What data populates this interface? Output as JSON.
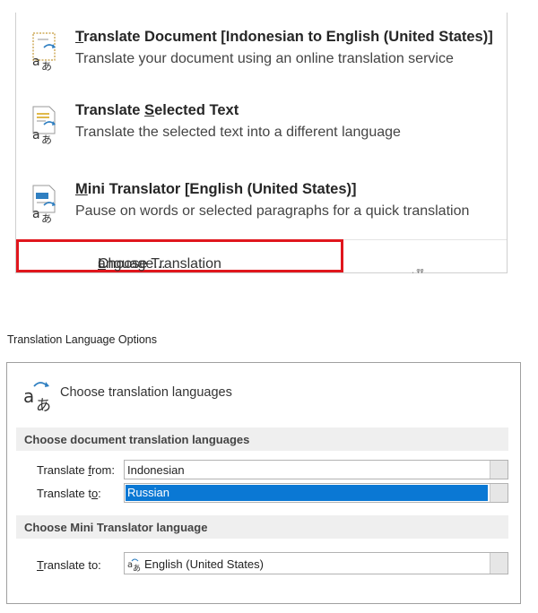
{
  "menu": {
    "items": [
      {
        "title_accel": "T",
        "title_rest": "ranslate Document [Indonesian to English (United States)]",
        "description": "Translate your document using an online translation service",
        "icon": "translate-document-icon"
      },
      {
        "title_pre": "Translate ",
        "title_accel": "S",
        "title_rest": "elected Text",
        "description": "Translate the selected text into a different language",
        "icon": "translate-selected-text-icon"
      },
      {
        "title_accel": "M",
        "title_rest": "ini Translator [English (United States)]",
        "description": "Pause on words or selected paragraphs for a quick translation",
        "icon": "mini-translator-icon"
      }
    ],
    "choose_language": {
      "pre": "Choose Translation ",
      "accel": "L",
      "rest": "anguage..."
    },
    "highlight_color": "#e0161d"
  },
  "dialog": {
    "title": "Translation Language Options",
    "header": "Choose translation languages",
    "header_icon": "translate-icon",
    "doc_section": {
      "title": "Choose document translation languages",
      "from_label_pre": "Translate ",
      "from_label_accel": "f",
      "from_label_rest": "rom:",
      "from_value": "Indonesian",
      "to_label_pre": "Translate t",
      "to_label_accel": "o",
      "to_label_rest": ":",
      "to_value": "Russian"
    },
    "mini_section": {
      "title": "Choose Mini Translator language",
      "label_accel": "T",
      "label_rest": "ranslate to:",
      "value": "English (United States)"
    },
    "selection_color": "#0a78d4"
  }
}
